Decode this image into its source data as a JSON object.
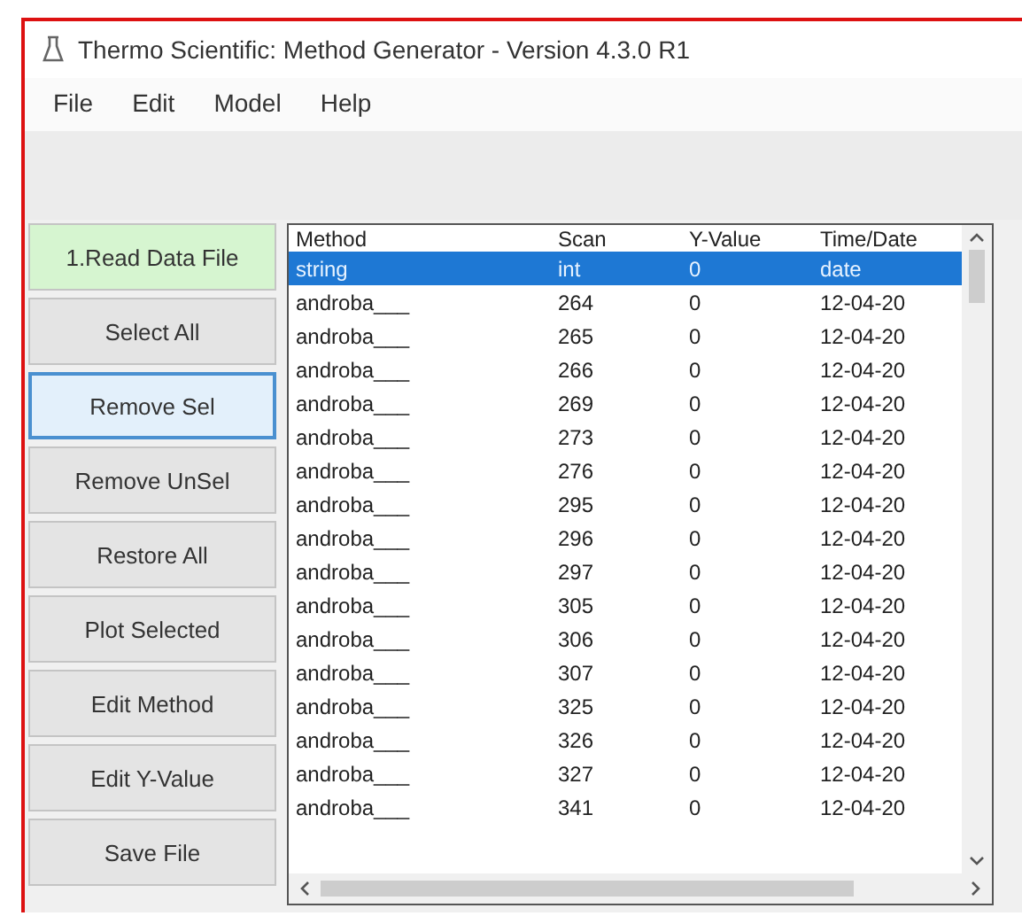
{
  "window": {
    "title": "Thermo Scientific: Method Generator - Version 4.3.0 R1"
  },
  "menu": [
    "File",
    "Edit",
    "Model",
    "Help"
  ],
  "buttons": [
    {
      "label": "1.Read Data File",
      "highlighted": true,
      "focused": false
    },
    {
      "label": "Select All",
      "highlighted": false,
      "focused": false
    },
    {
      "label": "Remove Sel",
      "highlighted": false,
      "focused": true
    },
    {
      "label": "Remove UnSel",
      "highlighted": false,
      "focused": false
    },
    {
      "label": "Restore All",
      "highlighted": false,
      "focused": false
    },
    {
      "label": "Plot Selected",
      "highlighted": false,
      "focused": false
    },
    {
      "label": "Edit Method",
      "highlighted": false,
      "focused": false
    },
    {
      "label": "Edit Y-Value",
      "highlighted": false,
      "focused": false
    },
    {
      "label": "Save File",
      "highlighted": false,
      "focused": false
    }
  ],
  "table": {
    "columns": [
      "Method",
      "Scan",
      "Y-Value",
      "Time/Date"
    ],
    "rows": [
      {
        "cells": [
          "string",
          "int",
          "0",
          "date"
        ],
        "selected": true
      },
      {
        "cells": [
          "androba___",
          "264",
          "0",
          "12-04-20"
        ],
        "selected": false
      },
      {
        "cells": [
          "androba___",
          "265",
          "0",
          "12-04-20"
        ],
        "selected": false
      },
      {
        "cells": [
          "androba___",
          "266",
          "0",
          "12-04-20"
        ],
        "selected": false
      },
      {
        "cells": [
          "androba___",
          "269",
          "0",
          "12-04-20"
        ],
        "selected": false
      },
      {
        "cells": [
          "androba___",
          "273",
          "0",
          "12-04-20"
        ],
        "selected": false
      },
      {
        "cells": [
          "androba___",
          "276",
          "0",
          "12-04-20"
        ],
        "selected": false
      },
      {
        "cells": [
          "androba___",
          "295",
          "0",
          "12-04-20"
        ],
        "selected": false
      },
      {
        "cells": [
          "androba___",
          "296",
          "0",
          "12-04-20"
        ],
        "selected": false
      },
      {
        "cells": [
          "androba___",
          "297",
          "0",
          "12-04-20"
        ],
        "selected": false
      },
      {
        "cells": [
          "androba___",
          "305",
          "0",
          "12-04-20"
        ],
        "selected": false
      },
      {
        "cells": [
          "androba___",
          "306",
          "0",
          "12-04-20"
        ],
        "selected": false
      },
      {
        "cells": [
          "androba___",
          "307",
          "0",
          "12-04-20"
        ],
        "selected": false
      },
      {
        "cells": [
          "androba___",
          "325",
          "0",
          "12-04-20"
        ],
        "selected": false
      },
      {
        "cells": [
          "androba___",
          "326",
          "0",
          "12-04-20"
        ],
        "selected": false
      },
      {
        "cells": [
          "androba___",
          "327",
          "0",
          "12-04-20"
        ],
        "selected": false
      },
      {
        "cells": [
          "androba___",
          "341",
          "0",
          "12-04-20"
        ],
        "selected": false
      }
    ]
  }
}
